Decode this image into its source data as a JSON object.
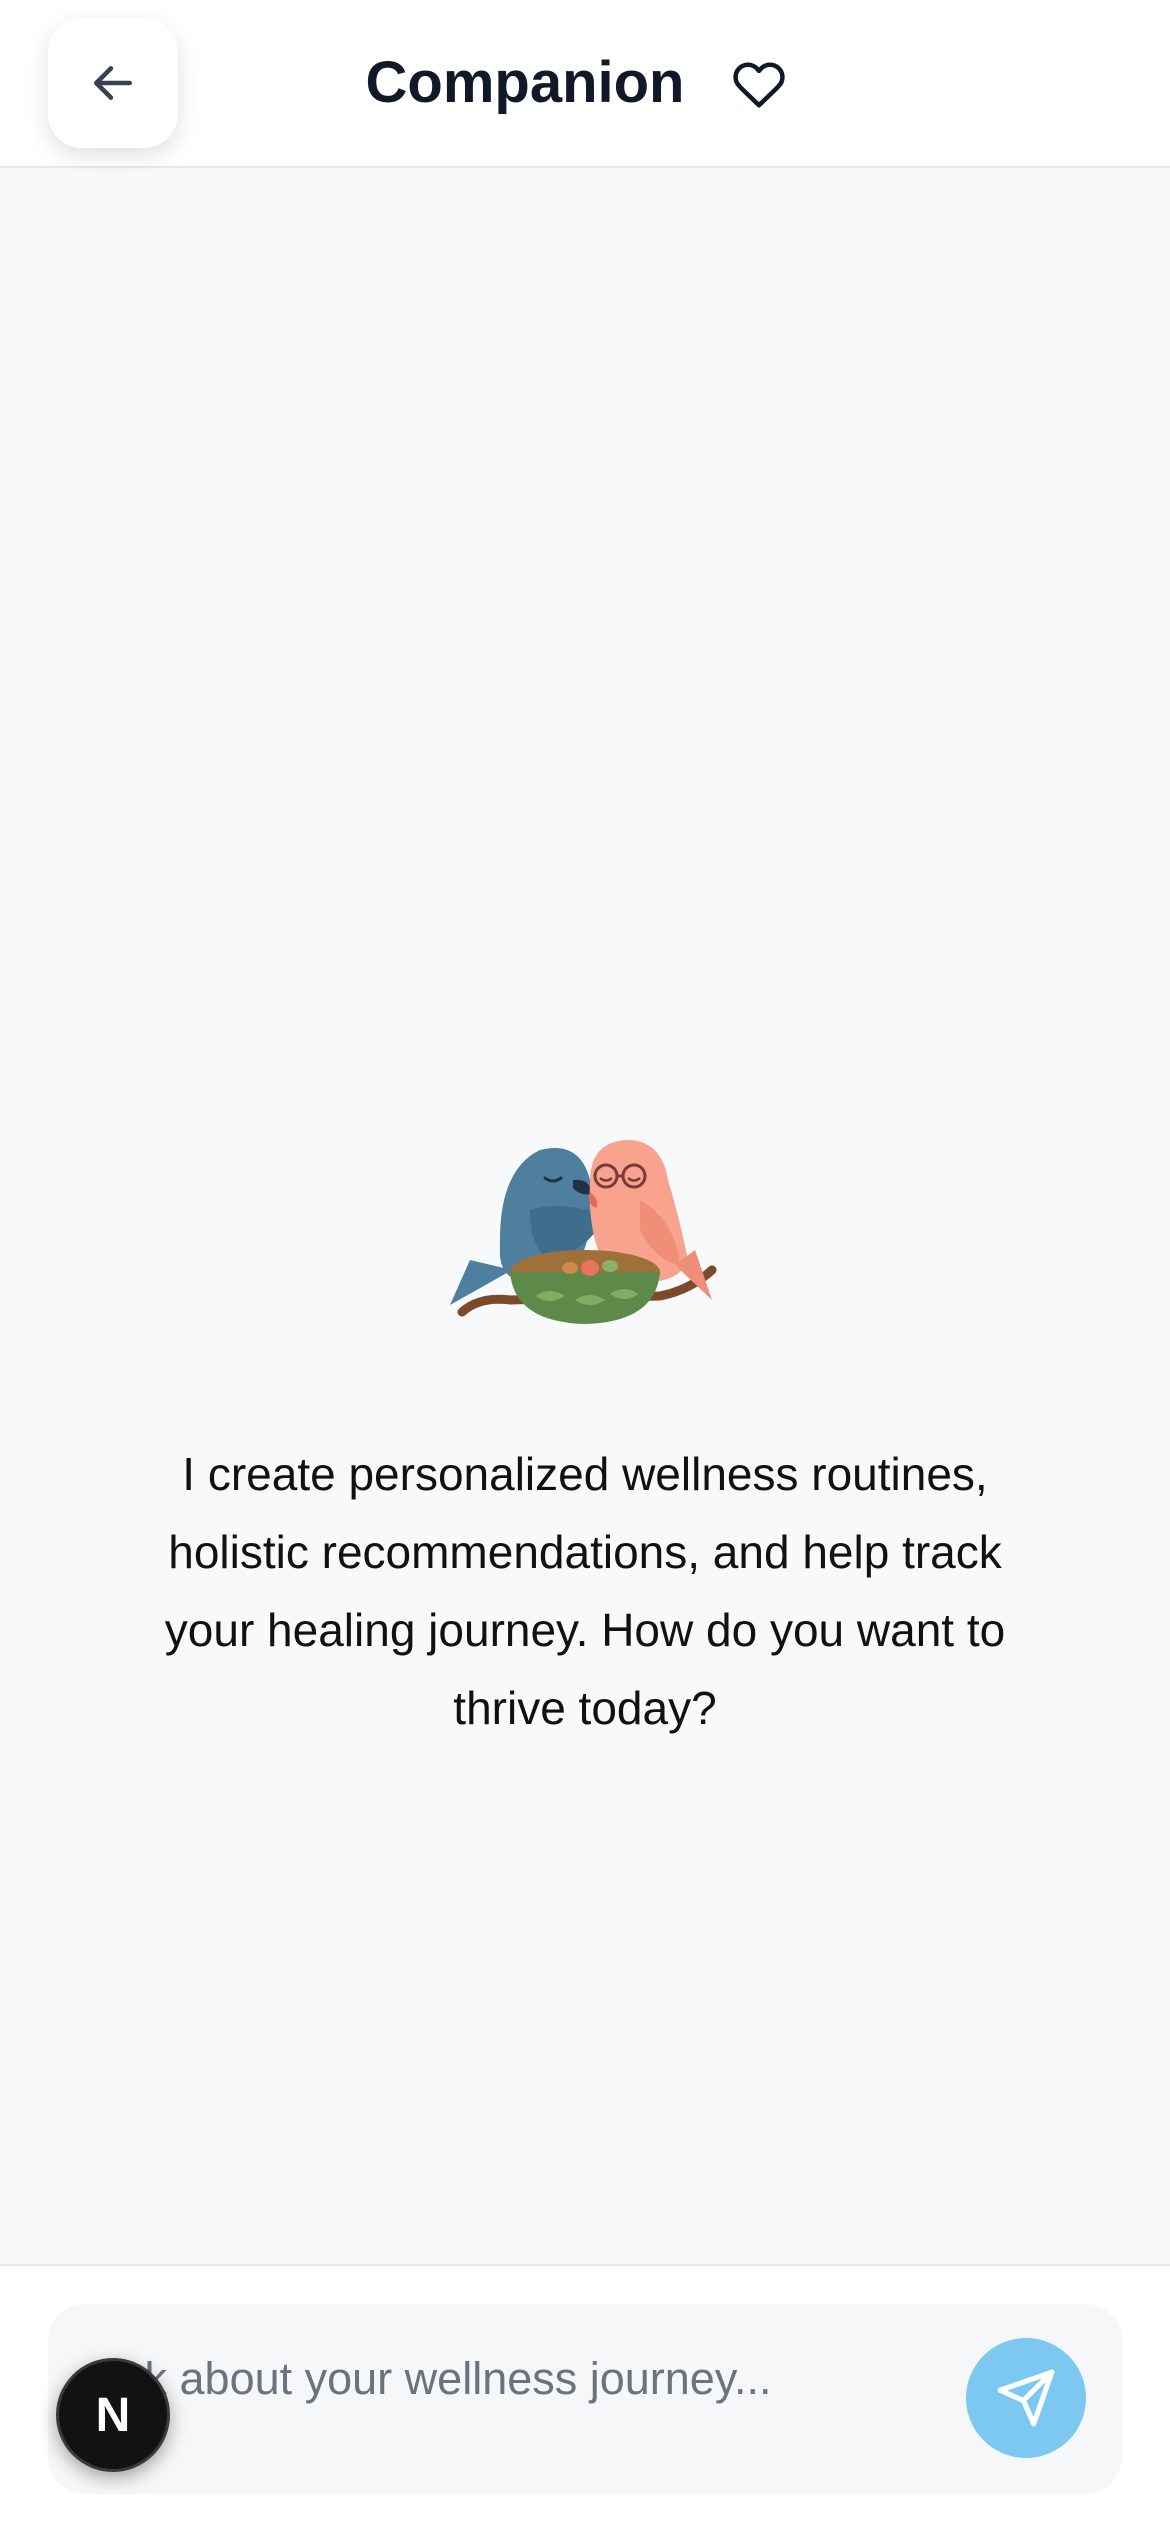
{
  "header": {
    "title": "Companion",
    "back_icon": "arrow-left-icon",
    "favorite_icon": "heart-icon"
  },
  "main": {
    "illustration": "two-lovebirds-in-nest",
    "intro_text": "I create personalized wellness routines, holistic recommendations, and help track your healing journey. How do you want to thrive today?"
  },
  "composer": {
    "placeholder": "Ask about your wellness journey...",
    "value": "",
    "send_icon": "send-icon"
  },
  "badge": {
    "label": "N"
  },
  "colors": {
    "send_button": "#7cc8f0",
    "background": "#f8f9fb",
    "text": "#111827"
  }
}
